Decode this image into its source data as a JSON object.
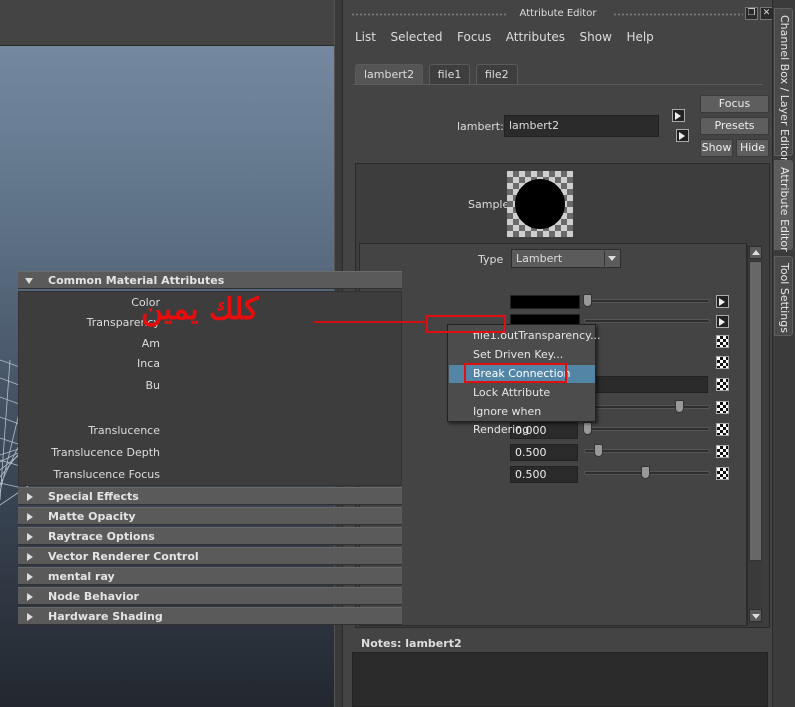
{
  "viewport": {
    "bg_top": "#7a8ea6",
    "bg_bottom": "#23282f"
  },
  "window": {
    "title": "Attribute Editor",
    "restore_glyph": "❐",
    "close_glyph": "✕"
  },
  "menubar": [
    "List",
    "Selected",
    "Focus",
    "Attributes",
    "Show",
    "Help"
  ],
  "tabs": [
    "lambert2",
    "file1",
    "file2"
  ],
  "node": {
    "label": "lambert:",
    "value": "lambert2"
  },
  "buttons": {
    "focus": "Focus",
    "presets": "Presets",
    "show": "Show",
    "hide": "Hide"
  },
  "sample": {
    "label": "Sample"
  },
  "type": {
    "label": "Type",
    "value": "Lambert"
  },
  "common_section": "Common Material Attributes",
  "attributes": [
    {
      "label": "Color",
      "kind": "color"
    },
    {
      "label": "Transparency",
      "kind": "color"
    },
    {
      "label": "Am",
      "kind": "color"
    },
    {
      "label": "Inca",
      "kind": "color"
    },
    {
      "label": "Bu",
      "kind": "field"
    },
    {
      "label": "",
      "kind": "slider",
      "value_frac": 0.78
    },
    {
      "label": "Translucence",
      "value": "0.000",
      "value_frac": 0.0
    },
    {
      "label": "Translucence Depth",
      "value": "0.500",
      "value_frac": 0.1
    },
    {
      "label": "Translucence Focus",
      "value": "0.500",
      "value_frac": 0.5
    }
  ],
  "sections": [
    "Special Effects",
    "Matte Opacity",
    "Raytrace Options",
    "Vector Renderer Control",
    "mental ray",
    "Node Behavior",
    "Hardware Shading"
  ],
  "notes": {
    "label": "Notes:",
    "node": "lambert2"
  },
  "side_tabs": [
    "Channel Box / Layer Editor",
    "Attribute Editor",
    "Tool Settings"
  ],
  "context_menu": [
    "file1.outTransparency...",
    "Set Driven Key...",
    "Break Connection",
    "Lock Attribute",
    "Ignore when Rendering"
  ],
  "context_highlight": "Break Connection",
  "annotation": {
    "text": "كلك يمين",
    "color": "#e80c0c"
  }
}
